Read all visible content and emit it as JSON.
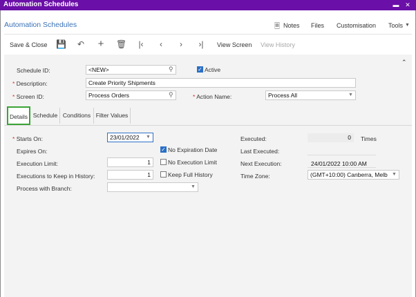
{
  "window": {
    "title": "Automation Schedules"
  },
  "header": {
    "title": "Automation Schedules",
    "links": {
      "notes": "Notes",
      "files": "Files",
      "customisation": "Customisation",
      "tools": "Tools"
    }
  },
  "toolbar": {
    "save_close": "Save & Close",
    "view_screen": "View Screen",
    "view_history": "View History"
  },
  "form": {
    "schedule_id_label": "Schedule ID:",
    "schedule_id_value": "<NEW>",
    "active_label": "Active",
    "description_label": "Description:",
    "description_value": "Create Priority Shipments",
    "screen_id_label": "Screen ID:",
    "screen_id_value": "Process Orders",
    "action_name_label": "Action Name:",
    "action_name_value": "Process All"
  },
  "tabs": [
    "Details",
    "Schedule",
    "Conditions",
    "Filter Values"
  ],
  "details": {
    "starts_on_label": "Starts On:",
    "starts_on_value": "23/01/2022",
    "expires_on_label": "Expires On:",
    "no_expiration_label": "No Expiration Date",
    "execution_limit_label": "Execution Limit:",
    "execution_limit_value": "1",
    "no_execution_limit_label": "No Execution Limit",
    "keep_history_label": "Executions to Keep in History:",
    "keep_history_value": "1",
    "keep_full_history_label": "Keep Full History",
    "process_branch_label": "Process with Branch:",
    "process_branch_value": "",
    "executed_label": "Executed:",
    "executed_value": "0",
    "times_label": "Times",
    "last_executed_label": "Last Executed:",
    "last_executed_value": "",
    "next_execution_label": "Next Execution:",
    "next_execution_value": "24/01/2022 10:00 AM",
    "time_zone_label": "Time Zone:",
    "time_zone_value": "(GMT+10:00) Canberra, Melb"
  },
  "colors": {
    "titlebar": "#6a0fa7",
    "accent_link": "#3a72b6",
    "tab_highlight": "#3aa335",
    "required": "#d93025"
  }
}
